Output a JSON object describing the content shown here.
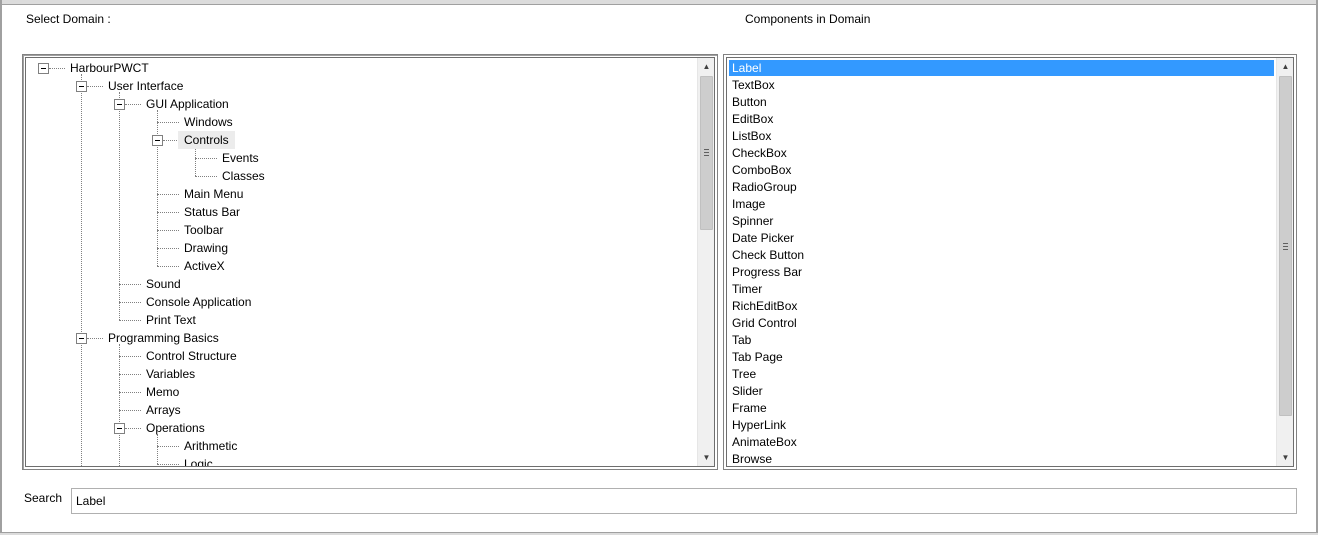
{
  "labels": {
    "select_domain": "Select Domain :",
    "components_in_domain": "Components in Domain",
    "search": "Search"
  },
  "tree": {
    "nodes": [
      {
        "label": "HarbourPWCT",
        "level": 0,
        "expanded": true,
        "selected": false
      },
      {
        "label": "User Interface",
        "level": 1,
        "expanded": true,
        "selected": false
      },
      {
        "label": "GUI Application",
        "level": 2,
        "expanded": true,
        "selected": false
      },
      {
        "label": "Windows",
        "level": 3,
        "expanded": false,
        "selected": false
      },
      {
        "label": "Controls",
        "level": 3,
        "expanded": true,
        "selected": true
      },
      {
        "label": "Events",
        "level": 4,
        "expanded": false,
        "selected": false
      },
      {
        "label": "Classes",
        "level": 4,
        "expanded": false,
        "selected": false
      },
      {
        "label": "Main Menu",
        "level": 3,
        "expanded": false,
        "selected": false
      },
      {
        "label": "Status Bar",
        "level": 3,
        "expanded": false,
        "selected": false
      },
      {
        "label": "Toolbar",
        "level": 3,
        "expanded": false,
        "selected": false
      },
      {
        "label": "Drawing",
        "level": 3,
        "expanded": false,
        "selected": false
      },
      {
        "label": "ActiveX",
        "level": 3,
        "expanded": false,
        "selected": false
      },
      {
        "label": "Sound",
        "level": 2,
        "expanded": false,
        "selected": false
      },
      {
        "label": "Console Application",
        "level": 2,
        "expanded": false,
        "selected": false
      },
      {
        "label": "Print Text",
        "level": 2,
        "expanded": false,
        "selected": false
      },
      {
        "label": "Programming Basics",
        "level": 1,
        "expanded": true,
        "selected": false
      },
      {
        "label": "Control Structure",
        "level": 2,
        "expanded": false,
        "selected": false
      },
      {
        "label": "Variables",
        "level": 2,
        "expanded": false,
        "selected": false
      },
      {
        "label": "Memo",
        "level": 2,
        "expanded": false,
        "selected": false
      },
      {
        "label": "Arrays",
        "level": 2,
        "expanded": false,
        "selected": false
      },
      {
        "label": "Operations",
        "level": 2,
        "expanded": true,
        "selected": false
      },
      {
        "label": "Arithmetic",
        "level": 3,
        "expanded": false,
        "selected": false
      },
      {
        "label": "Logic",
        "level": 3,
        "expanded": false,
        "selected": false
      }
    ]
  },
  "components": {
    "selected": "Label",
    "items": [
      "Label",
      "TextBox",
      "Button",
      "EditBox",
      "ListBox",
      "CheckBox",
      "ComboBox",
      "RadioGroup",
      "Image",
      "Spinner",
      "Date Picker",
      "Check Button",
      "Progress Bar",
      "Timer",
      "RichEditBox",
      "Grid Control",
      "Tab",
      "Tab Page",
      "Tree",
      "Slider",
      "Frame",
      "HyperLink",
      "AnimateBox",
      "Browse"
    ]
  },
  "search": {
    "value": "Label"
  },
  "icons": {
    "scroll_up": "scroll-up-arrow-icon",
    "scroll_down": "scroll-down-arrow-icon",
    "expander": "collapse-minus-icon"
  },
  "colors": {
    "selection": "#3399ff",
    "tree_selection": "#ececec"
  }
}
